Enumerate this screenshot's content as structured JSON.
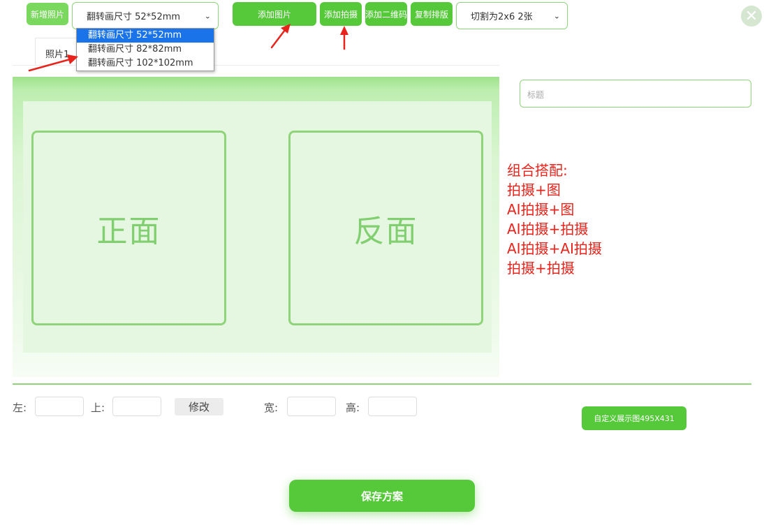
{
  "toolbar": {
    "new_photo": "新增照片",
    "size_select_value": "翻转画尺寸 52*52mm",
    "add_image": "添加图片",
    "add_capture": "添加拍摄",
    "add_qrcode": "添加二维码",
    "copy_layout": "复制排版",
    "cut_select_value": "切割为2x6 2张",
    "close_icon": "close-icon"
  },
  "size_dropdown": {
    "options": [
      "翻转画尺寸 52*52mm",
      "翻转画尺寸 82*82mm",
      "翻转画尺寸 102*102mm"
    ],
    "selected_index": 0
  },
  "tabs": [
    "照片1"
  ],
  "stage": {
    "front_label": "正面",
    "back_label": "反面"
  },
  "title_field": {
    "placeholder": "标题"
  },
  "note_lines": [
    "组合搭配:",
    "拍摄+图",
    "AI拍摄+图",
    "AI拍摄+拍摄",
    "AI拍摄+AI拍摄",
    "拍摄+拍摄"
  ],
  "position": {
    "left_label": "左:",
    "top_label": "上:",
    "modify_label": "修改",
    "width_label": "宽:",
    "height_label": "高:"
  },
  "custom_display_label": "自定义展示图495X431",
  "save_label": "保存方案",
  "colors": {
    "accent_green": "#55c93a",
    "annotation_red": "#e8231b",
    "selection_blue": "#1a73e8"
  }
}
